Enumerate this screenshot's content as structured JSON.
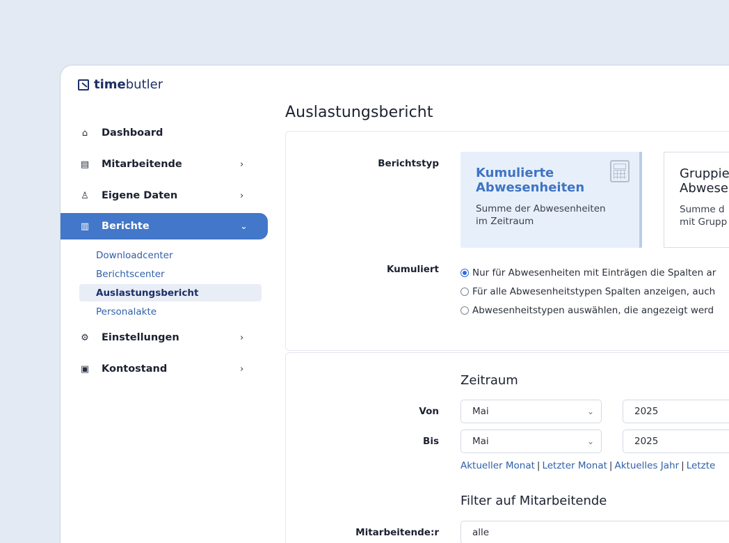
{
  "app": {
    "logo_bold": "time",
    "logo_rest": "butler"
  },
  "sidebar": {
    "items": [
      {
        "label": "Dashboard",
        "icon": "home-icon",
        "chevron": ""
      },
      {
        "label": "Mitarbeitende",
        "icon": "list-icon",
        "chevron": "›"
      },
      {
        "label": "Eigene Daten",
        "icon": "user-icon",
        "chevron": "›"
      },
      {
        "label": "Berichte",
        "icon": "chart-icon",
        "chevron": "⌄"
      },
      {
        "label": "Einstellungen",
        "icon": "gear-icon",
        "chevron": "›"
      },
      {
        "label": "Kontostand",
        "icon": "wallet-icon",
        "chevron": "›"
      }
    ],
    "subitems": [
      "Downloadcenter",
      "Berichtscenter",
      "Auslastungsbericht",
      "Personalakte"
    ]
  },
  "page": {
    "title": "Auslastungsbericht"
  },
  "report": {
    "type_label": "Berichtstyp",
    "types": [
      {
        "title_line1": "Kumulierte",
        "title_line2": "Abwesenheiten",
        "desc_line1": "Summe der Abwesenheiten",
        "desc_line2": "im Zeitraum",
        "selected": true
      },
      {
        "title_line1": "Gruppie",
        "title_line2": "Abwese",
        "desc_line1": "Summe d",
        "desc_line2": "mit Grupp",
        "selected": false
      }
    ],
    "cumulated_label": "Kumuliert",
    "options": [
      {
        "label": "Nur für Abwesenheiten mit Einträgen die Spalten ar",
        "checked": true
      },
      {
        "label": "Für alle Abwesenheitstypen Spalten anzeigen, auch",
        "checked": false
      },
      {
        "label": "Abwesenheitstypen auswählen, die angezeigt werd",
        "checked": false
      }
    ]
  },
  "period": {
    "title": "Zeitraum",
    "from_label": "Von",
    "to_label": "Bis",
    "from_month": "Mai",
    "from_year": "2025",
    "to_month": "Mai",
    "to_year": "2025",
    "quick_links": [
      "Aktueller Monat",
      "Letzter Monat",
      "Aktuelles Jahr",
      "Letzte"
    ]
  },
  "filter": {
    "title": "Filter auf Mitarbeitende",
    "employees_label": "Mitarbeitende:r",
    "employees_value": "alle"
  }
}
